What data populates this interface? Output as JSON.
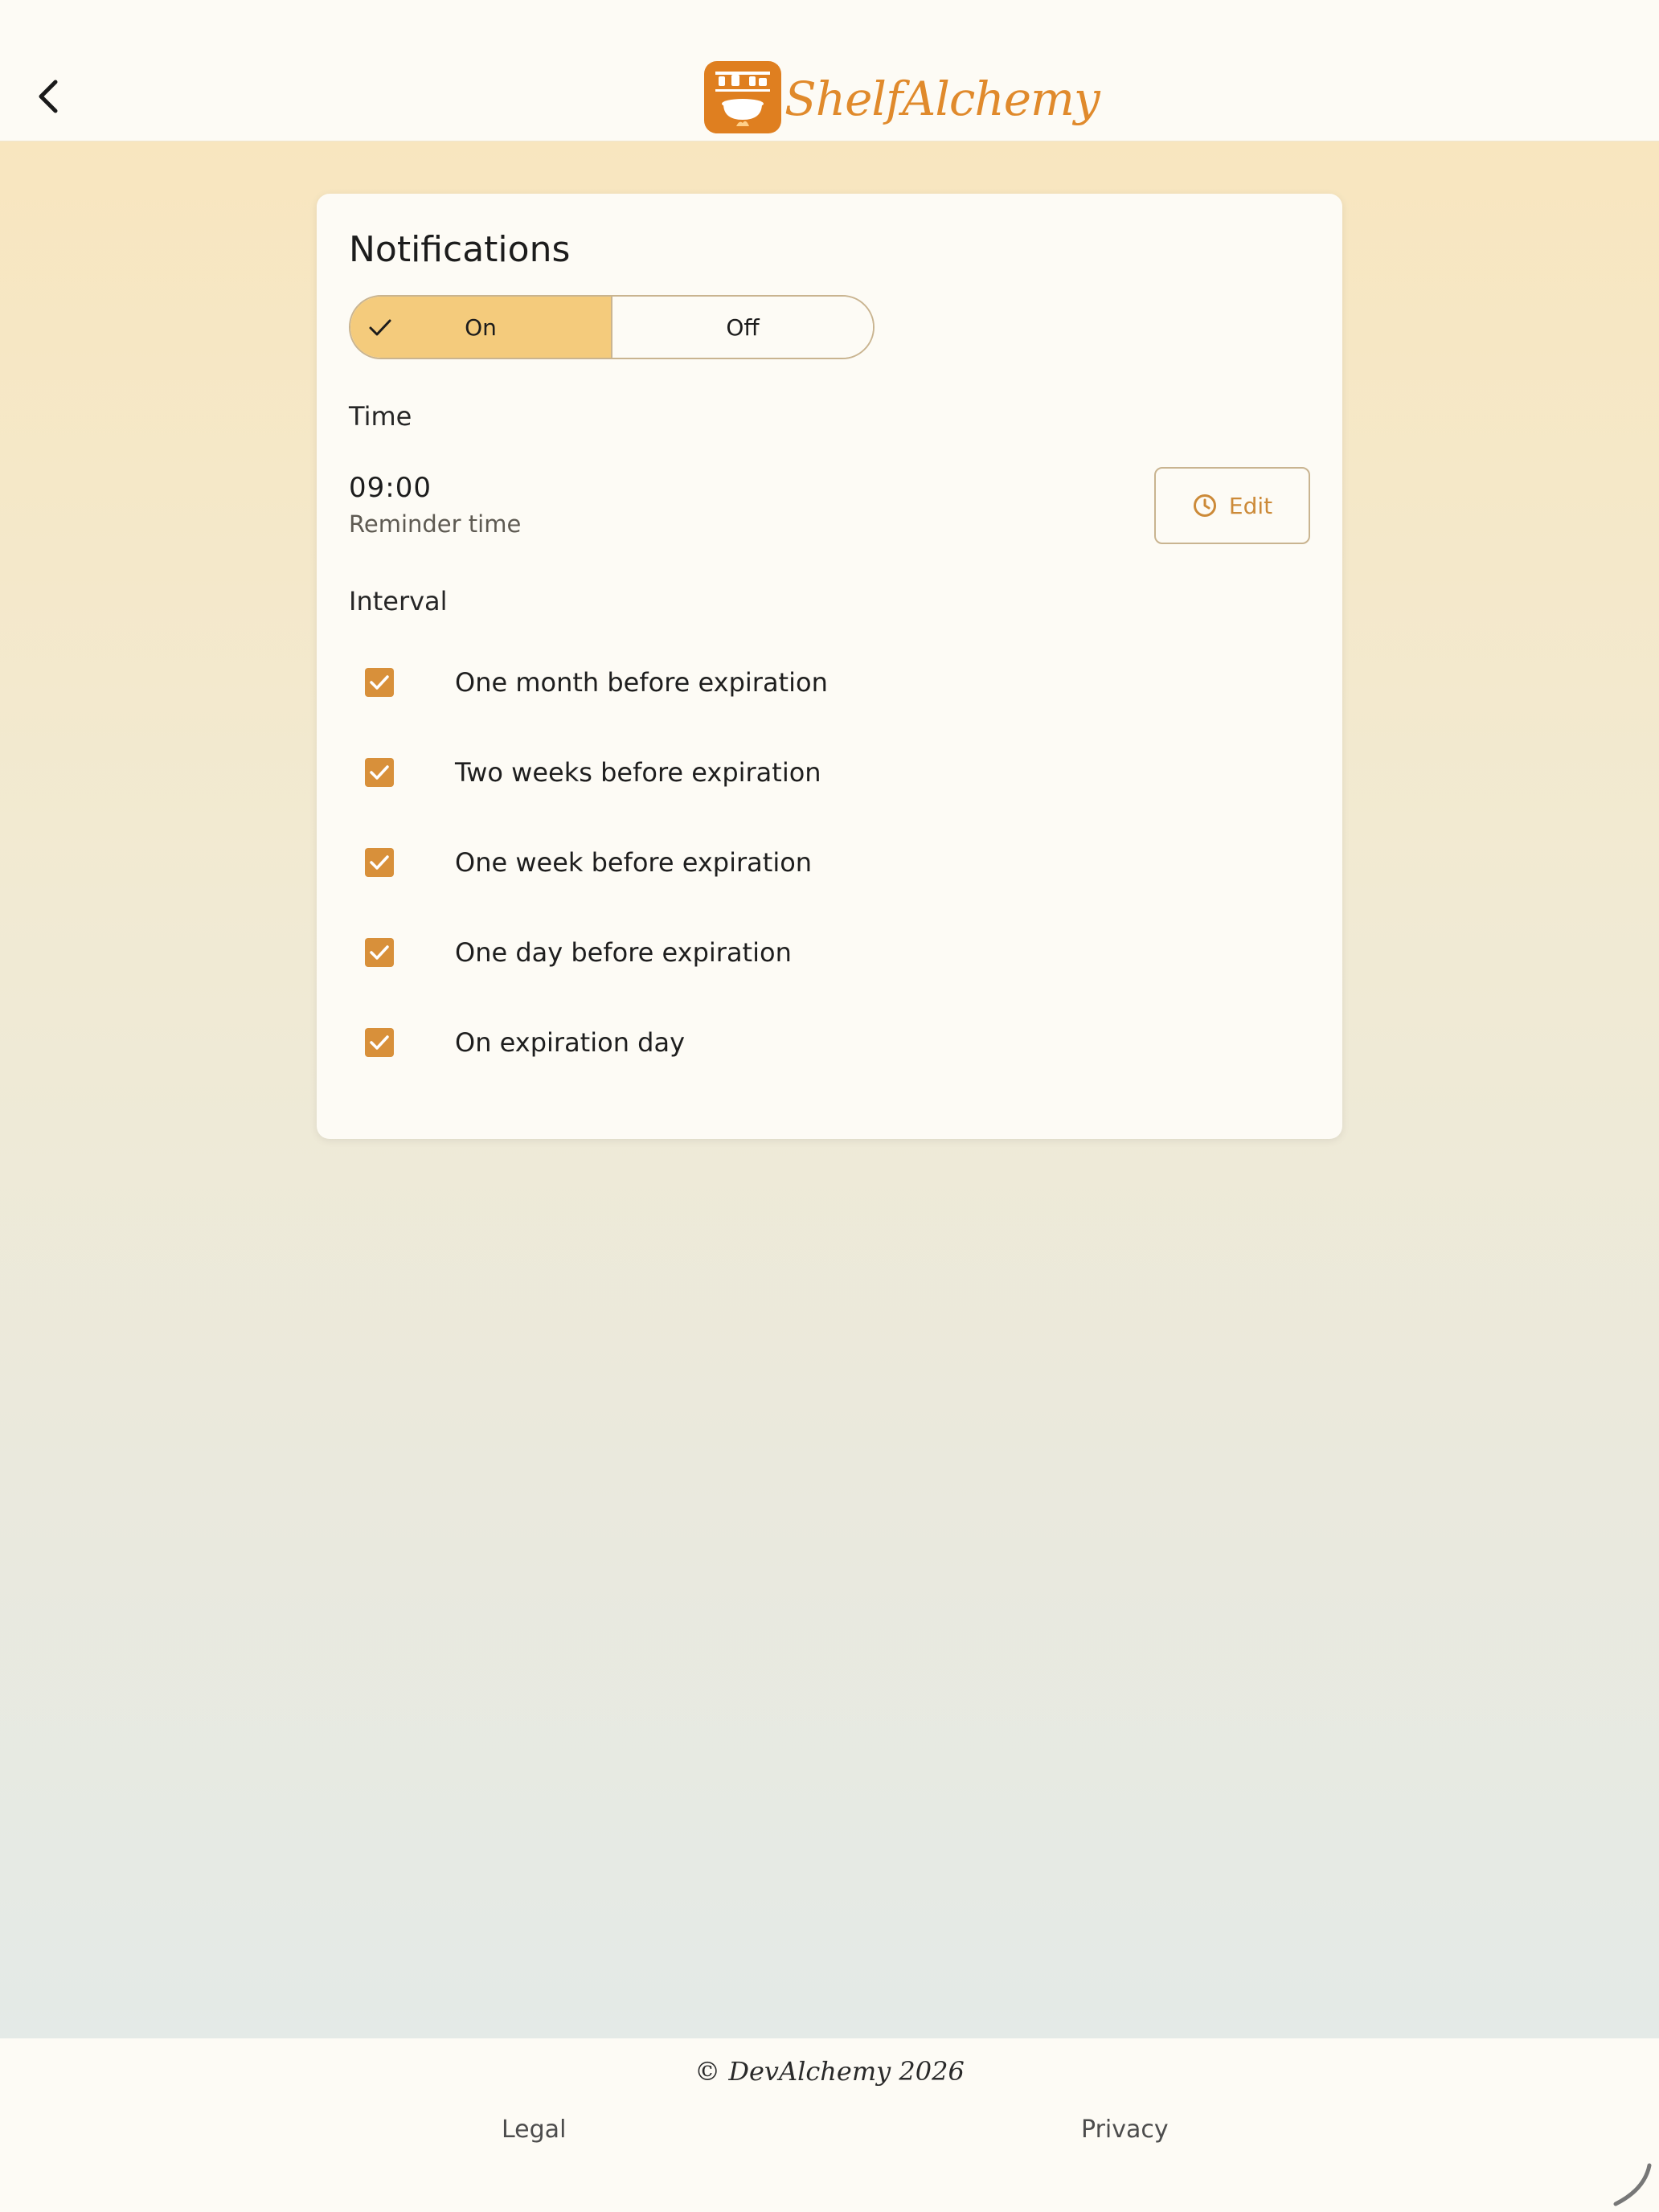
{
  "header": {
    "logo_text": "ShelfAlchemy",
    "back_icon": "chevron-left-icon"
  },
  "colors": {
    "accent": "#df7f20",
    "toggle_selected": "#f4cb7c",
    "checkbox": "#d8903a",
    "edit_text": "#cc8a38"
  },
  "notifications": {
    "title": "Notifications",
    "toggle": {
      "on_label": "On",
      "off_label": "Off",
      "selected": "On"
    },
    "time": {
      "section_label": "Time",
      "value": "09:00",
      "subtitle": "Reminder time",
      "edit_label": "Edit"
    },
    "interval": {
      "section_label": "Interval",
      "options": [
        {
          "label": "One month before expiration",
          "checked": true
        },
        {
          "label": "Two weeks before expiration",
          "checked": true
        },
        {
          "label": "One week before expiration",
          "checked": true
        },
        {
          "label": "One day before expiration",
          "checked": true
        },
        {
          "label": "On expiration day",
          "checked": true
        }
      ]
    }
  },
  "footer": {
    "copyright": "© DevAlchemy 2026",
    "legal_label": "Legal",
    "privacy_label": "Privacy"
  }
}
